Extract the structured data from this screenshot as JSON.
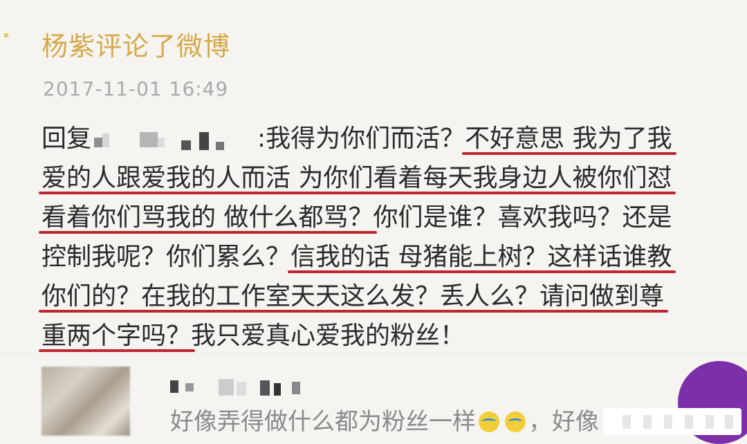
{
  "post": {
    "title": "杨紫评论了微博",
    "timestamp": "2017-11-01 16:49"
  },
  "comment": {
    "reply_prefix": "回复",
    "line1_a": ":我得为你们而活？",
    "line1_b": "不好意思 我为了我",
    "line2": "爱的人跟爱我的人而活 为你们看着每天我身边人被你们怼",
    "line3_a": "看着你们骂我的 做什么都骂？",
    "line3_b": "你们是谁？喜欢我吗？还是",
    "line4_a": "控制我呢？你们累么？",
    "line4_b": "信我的话 母猪能上树？这样话谁教",
    "line5": "你们的？在我的工作室天天这么发？丢人么？请问做到尊",
    "line6_a": "重两个字吗？",
    "line6_b": "我只爱真心爱我的粉丝！"
  },
  "reply": {
    "text_a": "好像弄得做什么都为粉丝一样",
    "text_b": "，好像",
    "emoji": "laughing-tears-icon"
  },
  "colors": {
    "title": "#d6a94a",
    "timestamp": "#a9a9a9",
    "underline": "#c0262f",
    "watermark_disc": "#7b2fa8"
  }
}
